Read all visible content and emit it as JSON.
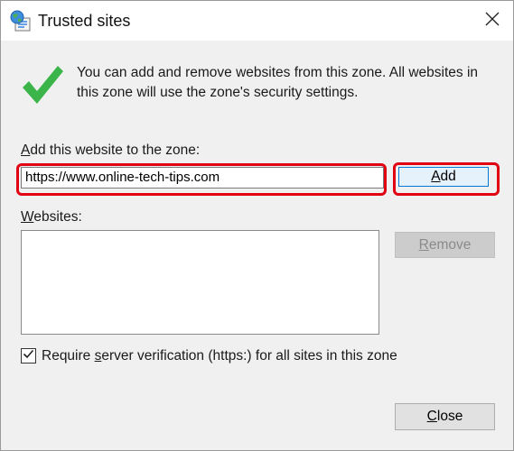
{
  "window": {
    "title": "Trusted sites"
  },
  "description": "You can add and remove websites from this zone. All websites in this zone will use the zone's security settings.",
  "add_section": {
    "label_accel": "A",
    "label_rest": "dd this website to the zone:",
    "url_value": "https://www.online-tech-tips.com",
    "add_button": {
      "accel": "A",
      "rest": "dd"
    }
  },
  "websites_section": {
    "label_accel": "W",
    "label_rest": "ebsites:",
    "items": [],
    "remove_button": {
      "accel": "R",
      "rest": "emove",
      "enabled": false
    }
  },
  "require_verification": {
    "checked": true,
    "label_pre": "Require ",
    "label_accel": "s",
    "label_post": "erver verification (https:) for all sites in this zone"
  },
  "close_button": {
    "accel": "C",
    "rest": "lose"
  },
  "icons": {
    "title": "globe-list-icon",
    "check": "green-checkmark-icon",
    "close": "close-x-icon"
  },
  "colors": {
    "highlight": "#e00012",
    "check_green": "#3bb54a"
  }
}
